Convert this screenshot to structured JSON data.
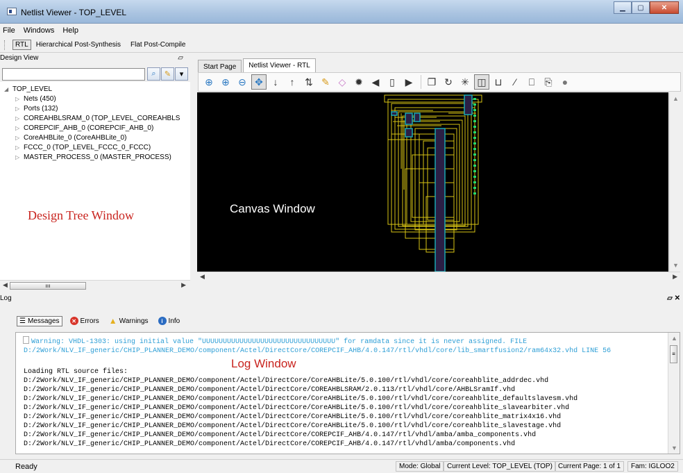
{
  "window": {
    "title": "Netlist Viewer - TOP_LEVEL"
  },
  "menu": [
    "File",
    "Windows",
    "Help"
  ],
  "views": [
    "RTL",
    "Hierarchical Post-Synthesis",
    "Flat Post-Compile"
  ],
  "design_view": {
    "title": "Design View",
    "search_placeholder": "",
    "root": "TOP_LEVEL",
    "items": [
      "Nets (450)",
      "Ports (132)",
      "COREAHBLSRAM_0 (TOP_LEVEL_COREAHBLS",
      "COREPCIF_AHB_0 (COREPCIF_AHB_0)",
      "CoreAHBLite_0 (CoreAHBLite_0)",
      "FCCC_0 (TOP_LEVEL_FCCC_0_FCCC)",
      "MASTER_PROCESS_0 (MASTER_PROCESS)"
    ],
    "annotation": "Design Tree Window"
  },
  "tabs": [
    "Start Page",
    "Netlist Viewer - RTL"
  ],
  "canvas": {
    "annotation": "Canvas Window"
  },
  "log": {
    "title": "Log",
    "tabs": [
      "Messages",
      "Errors",
      "Warnings",
      "Info"
    ],
    "annotation": "Log Window",
    "warning_lines": [
      "Warning: VHDL-1303:  using initial value \"UUUUUUUUUUUUUUUUUUUUUUUUUUUUUUUU\" for ramdata since it is never assigned. FILE",
      "D:/2Work/NLV_IF_generic/CHIP_PLANNER_DEMO/component/Actel/DirectCore/COREPCIF_AHB/4.0.147/rtl/vhdl/core/lib_smartfusion2/ram64x32.vhd LINE 56"
    ],
    "lines": [
      "Loading RTL source files:",
      "D:/2Work/NLV_IF_generic/CHIP_PLANNER_DEMO/component/Actel/DirectCore/CoreAHBLite/5.0.100/rtl/vhdl/core/coreahblite_addrdec.vhd",
      "D:/2Work/NLV_IF_generic/CHIP_PLANNER_DEMO/component/Actel/DirectCore/COREAHBLSRAM/2.0.113/rtl/vhdl/core/AHBLSramIf.vhd",
      "D:/2Work/NLV_IF_generic/CHIP_PLANNER_DEMO/component/Actel/DirectCore/CoreAHBLite/5.0.100/rtl/vhdl/core/coreahblite_defaultslavesm.vhd",
      "D:/2Work/NLV_IF_generic/CHIP_PLANNER_DEMO/component/Actel/DirectCore/CoreAHBLite/5.0.100/rtl/vhdl/core/coreahblite_slavearbiter.vhd",
      "D:/2Work/NLV_IF_generic/CHIP_PLANNER_DEMO/component/Actel/DirectCore/CoreAHBLite/5.0.100/rtl/vhdl/core/coreahblite_matrix4x16.vhd",
      "D:/2Work/NLV_IF_generic/CHIP_PLANNER_DEMO/component/Actel/DirectCore/CoreAHBLite/5.0.100/rtl/vhdl/core/coreahblite_slavestage.vhd",
      "D:/2Work/NLV_IF_generic/CHIP_PLANNER_DEMO/component/Actel/DirectCore/COREPCIF_AHB/4.0.147/rtl/vhdl/amba/amba_components.vhd",
      "D:/2Work/NLV_IF_generic/CHIP_PLANNER_DEMO/component/Actel/DirectCore/COREPCIF_AHB/4.0.147/rtl/vhdl/amba/components.vhd"
    ]
  },
  "status": {
    "ready": "Ready",
    "mode": "Mode: Global",
    "level": "Current Level: TOP_LEVEL (TOP)",
    "page": "Current Page:  1 of 1",
    "family": "Fam: IGLOO2"
  },
  "colors": {
    "annotation_red": "#c8231e",
    "warning_blue": "#2f9fd6",
    "canvas_bg": "#000000",
    "wire": "#d9c515",
    "block": "#2b1f45",
    "block_border": "#1aa9b4"
  }
}
